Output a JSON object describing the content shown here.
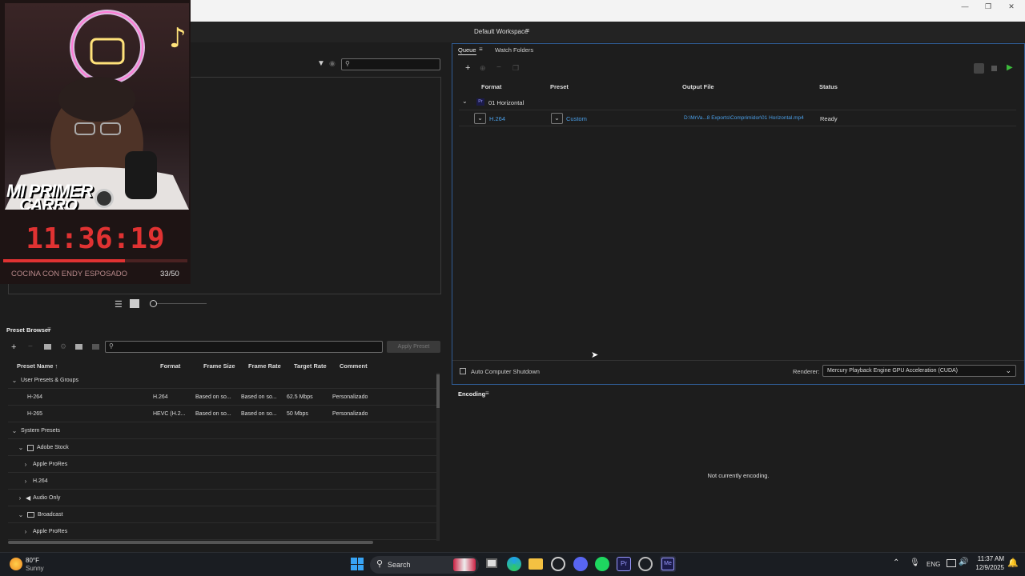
{
  "workspace": {
    "label": "Default Workspace"
  },
  "queue": {
    "tabs": [
      {
        "label": "Queue"
      },
      {
        "label": "Watch Folders"
      }
    ],
    "columns": [
      "Format",
      "Preset",
      "Output File",
      "Status"
    ],
    "group": {
      "name": "01 Horizontal",
      "badge": "Pr"
    },
    "items": [
      {
        "format": "H.264",
        "preset": "Custom",
        "output": "D:\\MrVa...8 Exports\\Comprimidor\\01 Horizontal.mp4",
        "status": "Ready"
      }
    ],
    "auto_shutdown": "Auto Computer Shutdown",
    "renderer_label": "Renderer:",
    "renderer_value": "Mercury Playback Engine GPU Acceleration (CUDA)"
  },
  "encoding": {
    "title": "Encoding",
    "status": "Not currently encoding."
  },
  "preset_browser": {
    "title": "Preset Browser",
    "apply_label": "Apply Preset",
    "columns": [
      "Preset Name",
      "Format",
      "Frame Size",
      "Frame Rate",
      "Target Rate",
      "Comment"
    ],
    "rows": [
      {
        "name": "User Presets & Groups",
        "level": 0,
        "expand": "down"
      },
      {
        "name": "H-264",
        "level": 2,
        "format": "H.264",
        "frame_size": "Based on so...",
        "frame_rate": "Based on so...",
        "target_rate": "62.5 Mbps",
        "comment": "Personalizado"
      },
      {
        "name": "H-265",
        "level": 2,
        "format": "HEVC (H.2...",
        "frame_size": "Based on so...",
        "frame_rate": "Based on so...",
        "target_rate": "50 Mbps",
        "comment": "Personalizado"
      },
      {
        "name": "System Presets",
        "level": 0,
        "expand": "down"
      },
      {
        "name": "Adobe Stock",
        "level": 1,
        "expand": "down",
        "icon": "stock"
      },
      {
        "name": "Apple ProRes",
        "level": 2,
        "expand": "right"
      },
      {
        "name": "H.264",
        "level": 2,
        "expand": "right"
      },
      {
        "name": "Audio Only",
        "level": 1,
        "expand": "right",
        "icon": "audio"
      },
      {
        "name": "Broadcast",
        "level": 1,
        "expand": "down",
        "icon": "tv"
      },
      {
        "name": "Apple ProRes",
        "level": 2,
        "expand": "right"
      }
    ]
  },
  "stream_overlay": {
    "title_line1": "MI PRIMER",
    "title_line2": "CARRO",
    "timer": "11:36:19",
    "progress": 0.66,
    "ticker": "COCINA CON ENDY ESPOSADO",
    "count": "33/50"
  },
  "taskbar": {
    "weather_temp": "80°F",
    "weather_desc": "Sunny",
    "search_label": "Search",
    "lang": "ENG",
    "time": "11:37 AM",
    "date": "12/9/2025"
  }
}
